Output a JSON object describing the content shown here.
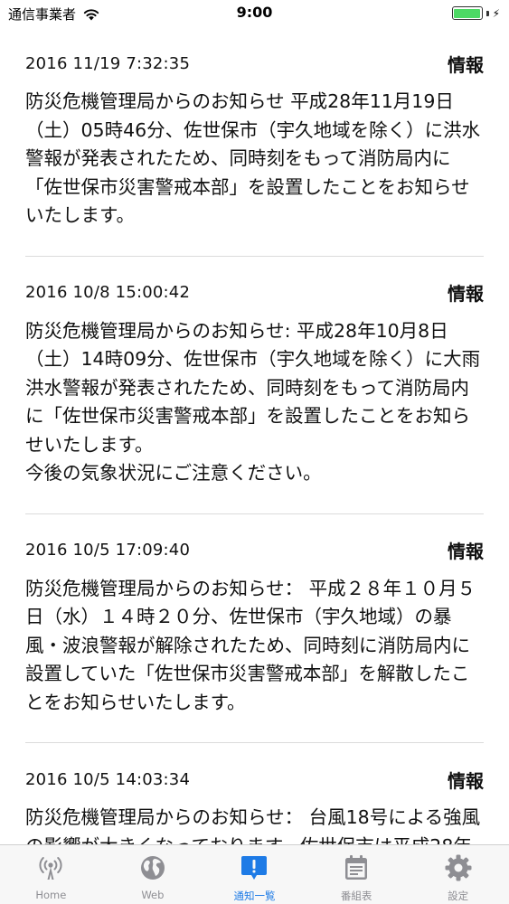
{
  "status_bar": {
    "carrier": "通信事業者",
    "time": "9:00"
  },
  "notices": [
    {
      "date": "2016 11/19 7:32:35",
      "type": "情報",
      "body": "防災危機管理局からのお知らせ 平成28年11月19日（土）05時46分、佐世保市（宇久地域を除く）に洪水警報が発表されたため、同時刻をもって消防局内に「佐世保市災害警戒本部」を設置したことをお知らせいたします。"
    },
    {
      "date": "2016 10/8 15:00:42",
      "type": "情報",
      "body": "防災危機管理局からのお知らせ: 平成28年10月8日（土）14時09分、佐世保市（宇久地域を除く）に大雨洪水警報が発表されたため、同時刻をもって消防局内に「佐世保市災害警戒本部」を設置したことをお知らせいたします。\n今後の気象状況にご注意ください。"
    },
    {
      "date": "2016 10/5 17:09:40",
      "type": "情報",
      "body": "防災危機管理局からのお知らせ： 平成２８年１０月５日（水）１４時２０分、佐世保市（宇久地域）の暴風・波浪警報が解除されたため、同時刻に消防局内に設置していた「佐世保市災害警戒本部」を解散したことをお知らせいたします。"
    },
    {
      "date": "2016 10/5 14:03:34",
      "type": "情報",
      "body": "防災危機管理局からのお知らせ： 台風18号による強風の影響が大きくなっております。佐世保市は平成28年"
    }
  ],
  "tabs": [
    {
      "label": "Home",
      "icon": "antenna-icon",
      "active": false
    },
    {
      "label": "Web",
      "icon": "globe-icon",
      "active": false
    },
    {
      "label": "通知一覧",
      "icon": "notification-icon",
      "active": true
    },
    {
      "label": "番組表",
      "icon": "calendar-icon",
      "active": false
    },
    {
      "label": "設定",
      "icon": "gear-icon",
      "active": false
    }
  ],
  "colors": {
    "accent": "#1e7be6",
    "tab_inactive": "#8e8e93",
    "battery": "#4cd964"
  }
}
